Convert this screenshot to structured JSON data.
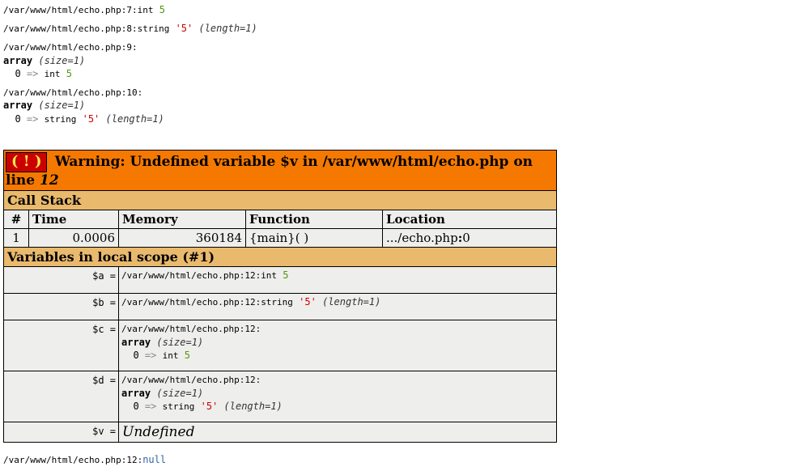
{
  "dumps": [
    {
      "file_line": "/var/www/html/echo.php:7:",
      "type": "int",
      "value": "5"
    },
    {
      "file_line": "/var/www/html/echo.php:8:",
      "type": "string",
      "value": "'5'",
      "length": "(length=1)"
    },
    {
      "file_line": "/var/www/html/echo.php:9:",
      "kind": "array",
      "array_size": "(size=1)",
      "idx": "0",
      "arrow": "=>",
      "elem_type": "int",
      "elem_value": "5"
    },
    {
      "file_line": "/var/www/html/echo.php:10:",
      "kind": "array",
      "array_size": "(size=1)",
      "idx": "0",
      "arrow": "=>",
      "elem_type": "string",
      "elem_value": "'5'",
      "elem_length": "(length=1)"
    }
  ],
  "error": {
    "exclaim": "( ! )",
    "prefix": "Warning: Undefined variable $v in /var/www/html/echo.php on line ",
    "line": "12"
  },
  "callstack_title": "Call Stack",
  "callstack_cols": {
    "c1": "#",
    "c2": "Time",
    "c3": "Memory",
    "c4": "Function",
    "c5": "Location"
  },
  "callstack_row": {
    "num": "1",
    "time": "0.0006",
    "mem": "360184",
    "func": "{main}( )",
    "loc_pre": ".../echo.php",
    "loc_bold": ":",
    "loc_line": "0"
  },
  "vars_title": "Variables in local scope (#1)",
  "vars": {
    "a": {
      "name": "$a =",
      "file_line": "/var/www/html/echo.php:12:",
      "type": "int",
      "value": "5"
    },
    "b": {
      "name": "$b =",
      "file_line": "/var/www/html/echo.php:12:",
      "type": "string",
      "value": "'5'",
      "length": "(length=1)"
    },
    "c": {
      "name": "$c =",
      "file_line": "/var/www/html/echo.php:12:",
      "kind": "array",
      "array_size": "(size=1)",
      "idx": "0",
      "arrow": "=>",
      "elem_type": "int",
      "elem_value": "5"
    },
    "d": {
      "name": "$d =",
      "file_line": "/var/www/html/echo.php:12:",
      "kind": "array",
      "array_size": "(size=1)",
      "idx": "0",
      "arrow": "=>",
      "elem_type": "string",
      "elem_value": "'5'",
      "elem_length": "(length=1)"
    },
    "v": {
      "name": "$v =",
      "undefined": "Undefined"
    }
  },
  "trailing": {
    "file_line": "/var/www/html/echo.php:12:",
    "value": "null"
  }
}
